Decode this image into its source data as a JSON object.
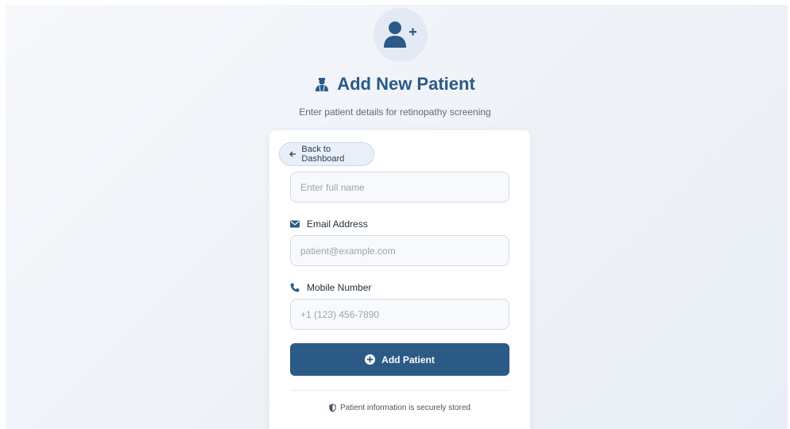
{
  "header": {
    "title": "Add New Patient",
    "subtitle": "Enter patient details for retinopathy screening",
    "avatar_icon": "user-plus-icon",
    "title_icon": "user-doctor-icon"
  },
  "form": {
    "back_label": "Back to Dashboard",
    "name_placeholder": "Enter full name",
    "email_label": "Email Address",
    "email_placeholder": "patient@example.com",
    "mobile_label": "Mobile Number",
    "mobile_placeholder": "+1 (123) 456-7890",
    "submit_label": "Add Patient",
    "secure_note": "Patient information is securely stored"
  },
  "colors": {
    "primary": "#2b5a86",
    "background": "#eef2f7",
    "card": "#ffffff"
  }
}
